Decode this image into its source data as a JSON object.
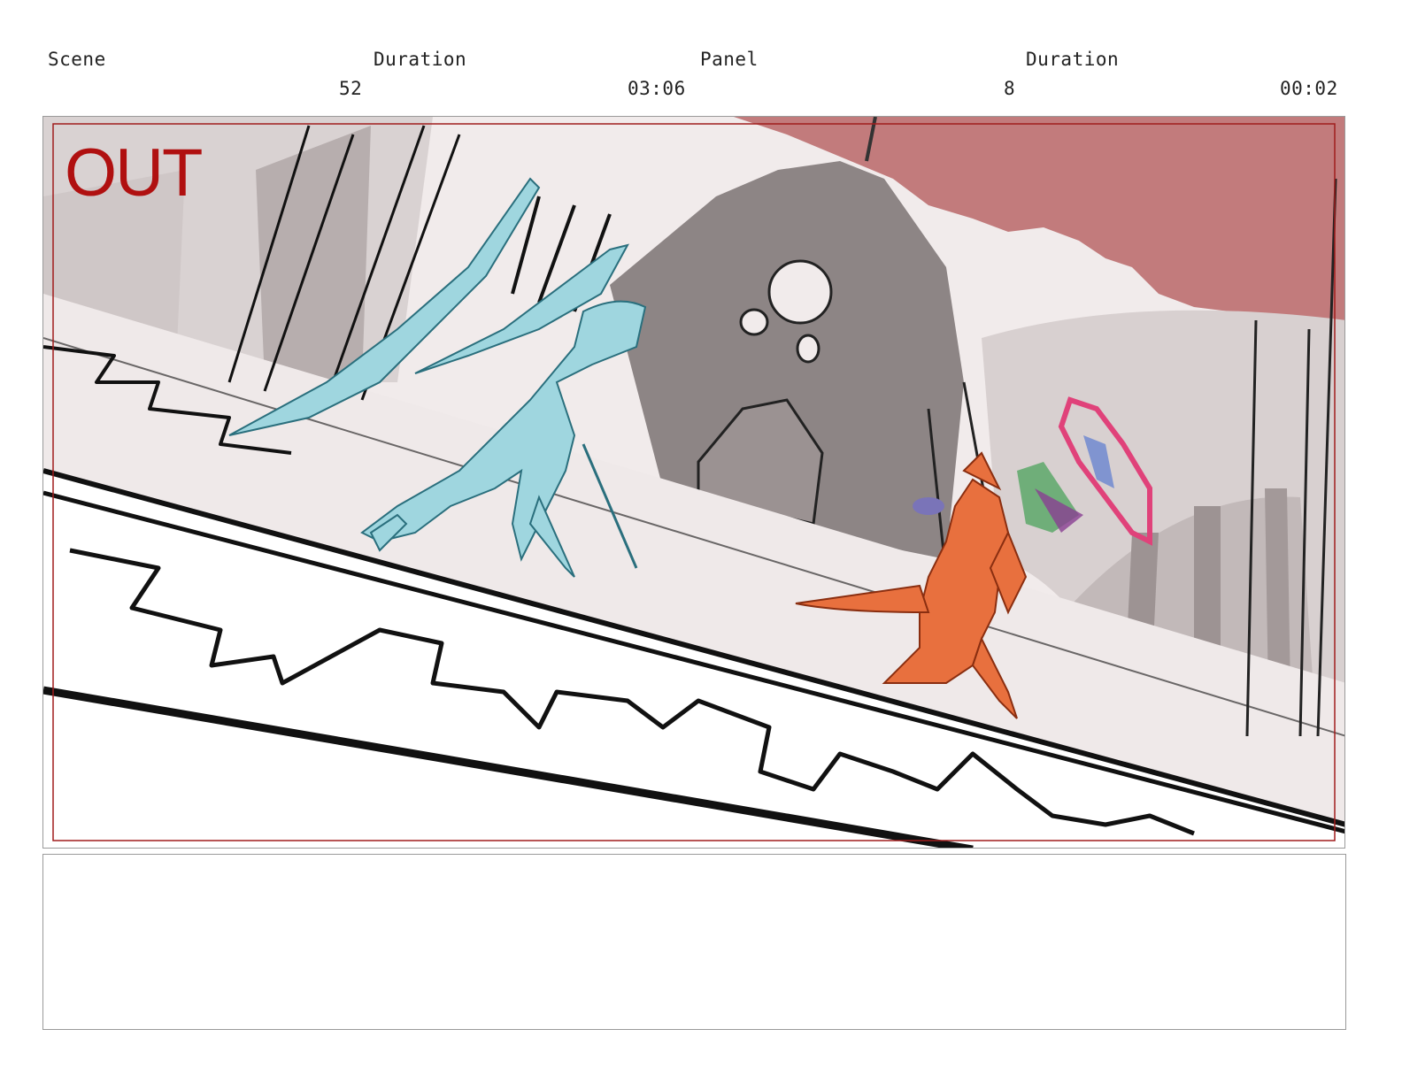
{
  "header": {
    "scene_label": "Scene",
    "scene_duration_label": "Duration",
    "panel_label": "Panel",
    "panel_duration_label": "Duration",
    "scene_number": "52",
    "scene_duration": "03:06",
    "panel_number": "8",
    "panel_duration": "00:02"
  },
  "panel": {
    "overlay_label": "OUT",
    "colors": {
      "sky_red": "#c27b7c",
      "safe_area": "#a01c1c",
      "demon_blue": "#9fd6df",
      "demon_orange": "#e8703e",
      "caster_pink": "#e0427a",
      "building_gray": "#8d8585"
    }
  },
  "notes": {
    "text": ""
  }
}
